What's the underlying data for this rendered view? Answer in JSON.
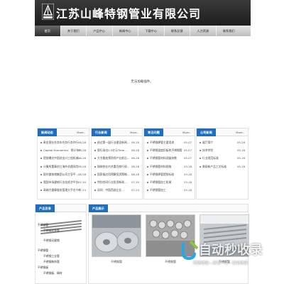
{
  "company": {
    "name": "江苏山峰特钢管业有限公司"
  },
  "nav": [
    "首页",
    "关于我们",
    "产品中心",
    "新闻中心",
    "下载中心",
    "联系反馈",
    "人力资源",
    "联系我们"
  ],
  "notice": "无法加载插件。",
  "panels": [
    {
      "tab": "新闻动态",
      "more": "More..",
      "rows": [
        {
          "title": "奉金营业任务车任务行务作行",
          "date": "08-28"
        },
        {
          "title": "Capital Economics：预计年内",
          "date": "08-28"
        },
        {
          "title": "提前曝光中国进出口工程机械…",
          "date": "08-28"
        },
        {
          "title": "计算所董事创立海外机遇风险",
          "date": "08-28"
        },
        {
          "title": "国外散装储集团公司主导平…",
          "date": "08-28"
        },
        {
          "title": "我国市场建筑行业化经济平台…",
          "date": "07-30"
        },
        {
          "title": "高端大健康服务管理大平台千中…",
          "date": "07-24"
        }
      ]
    },
    {
      "tab": "行业新闻",
      "more": "More..",
      "rows": [
        {
          "title": "经过第一届行业建设新闻…",
          "date": "08-28"
        },
        {
          "title": "银行拿出2.5亿元Time…",
          "date": "08-28"
        },
        {
          "title": "大字路准预防领产业前沿…",
          "date": "08-28"
        },
        {
          "title": "刚装修业内关重目前行规…",
          "date": "08-28"
        },
        {
          "title": "国家级应用预算投资策略…",
          "date": "08-28"
        },
        {
          "title": "特别合同行业投资新闻…",
          "date": "07-30"
        },
        {
          "title": "深圳：中国西部企业…",
          "date": "07-24"
        }
      ]
    },
    {
      "tab": "常见问题",
      "more": "More..",
      "rows": [
        {
          "title": "不锈钢焊管主要用途",
          "date": "05-07"
        },
        {
          "title": "不锈钢温度扣板和不锈钢管",
          "date": "05-07"
        },
        {
          "title": "不锈钢管材料测量参数",
          "date": "05-07"
        },
        {
          "title": "不锈钢管材料规格",
          "date": "03-18"
        },
        {
          "title": "不锈钢焊管提前标准",
          "date": "03-18"
        },
        {
          "title": "不锈钢管加工机械",
          "date": "03-18"
        },
        {
          "title": "不锈钢管加工",
          "date": "03-18"
        }
      ]
    },
    {
      "tab": "公司新闻",
      "more": "More..",
      "rows": [
        {
          "title": "展厅简介",
          "date": "05-26"
        },
        {
          "title": "技术特别",
          "date": "05-16"
        },
        {
          "title": "行业规范标准",
          "date": "05-16"
        },
        {
          "title": "美丽新产品工艺标准",
          "date": "05-16"
        }
      ]
    }
  ],
  "product_menu": {
    "tab": "产品目录",
    "items": [
      {
        "cat": "不锈钢管",
        "subs": [
          "不锈钢光亮管",
          "不锈钢无缝钢"
        ]
      },
      {
        "cat": "不锈钢管",
        "subs": [
          "不锈钢工业管",
          "不锈钢装饰管"
        ]
      },
      {
        "cat": "不锈钢板",
        "subs": [
          "不锈钢板、棒材"
        ]
      }
    ]
  },
  "product_show": {
    "tab": "产品展示",
    "captions": [
      "不锈钢管",
      "不锈钢管",
      "不锈钢管"
    ]
  },
  "watermark": {
    "title": "自动秒收录",
    "sub": "快速收录—来访一次—自动收录"
  }
}
